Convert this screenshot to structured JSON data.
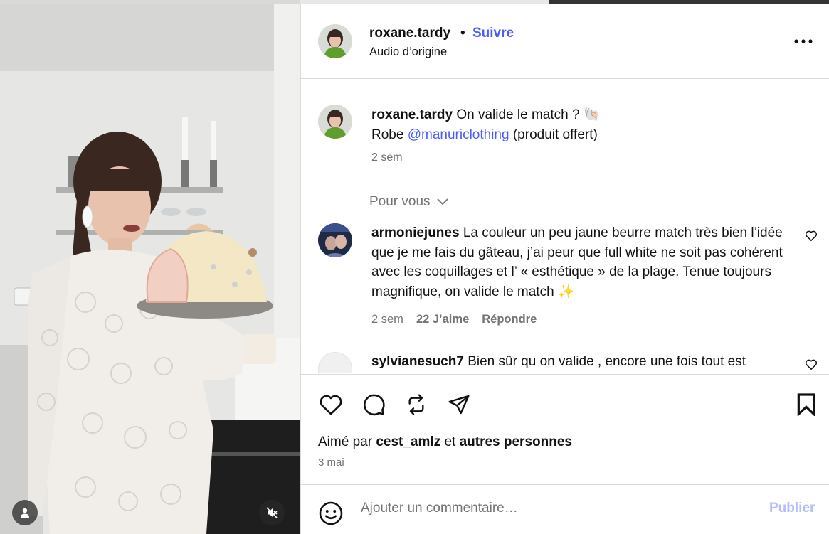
{
  "post": {
    "author": "roxane.tardy",
    "separator": "•",
    "follow_label": "Suivre",
    "audio": "Audio d’origine"
  },
  "caption": {
    "username": "roxane.tardy",
    "line1": "On valide le match ? 🐚",
    "line2_prefix": "Robe ",
    "mention": "@manuriclothing",
    "line2_suffix": " (produit offert)",
    "time": "2 sem"
  },
  "section_label": "Pour vous",
  "comments": [
    {
      "username": "armoniejunes",
      "text": "La couleur un peu jaune beurre match très bien l’idée que je me fais du gâteau, j’ai peur que full white ne soit pas cohérent avec les coquillages et l’ « esthétique » de la plage. Tenue toujours magnifique, on valide le match ✨",
      "time": "2 sem",
      "likes": "22 J’aime",
      "reply": "Répondre"
    },
    {
      "username": "sylvianesuch7",
      "text": "Bien sûr qu on valide , encore une fois tout est"
    }
  ],
  "likes_line": {
    "prefix": "Aimé par",
    "user": "cest_amlz",
    "middle": "et",
    "rest": "autres personnes"
  },
  "date": "3 mai",
  "comment_box": {
    "placeholder": "Ajouter un commentaire…",
    "publish_label": "Publier"
  },
  "colors": {
    "link": "#4a5df9",
    "publish_disabled": "#b3bdfb",
    "secondary_text": "#737373"
  },
  "icons": [
    "user-icon",
    "mute-icon",
    "more-icon",
    "heart-icon",
    "comment-icon",
    "repost-icon",
    "share-icon",
    "bookmark-icon",
    "emoji-icon",
    "chevron-down-icon"
  ]
}
